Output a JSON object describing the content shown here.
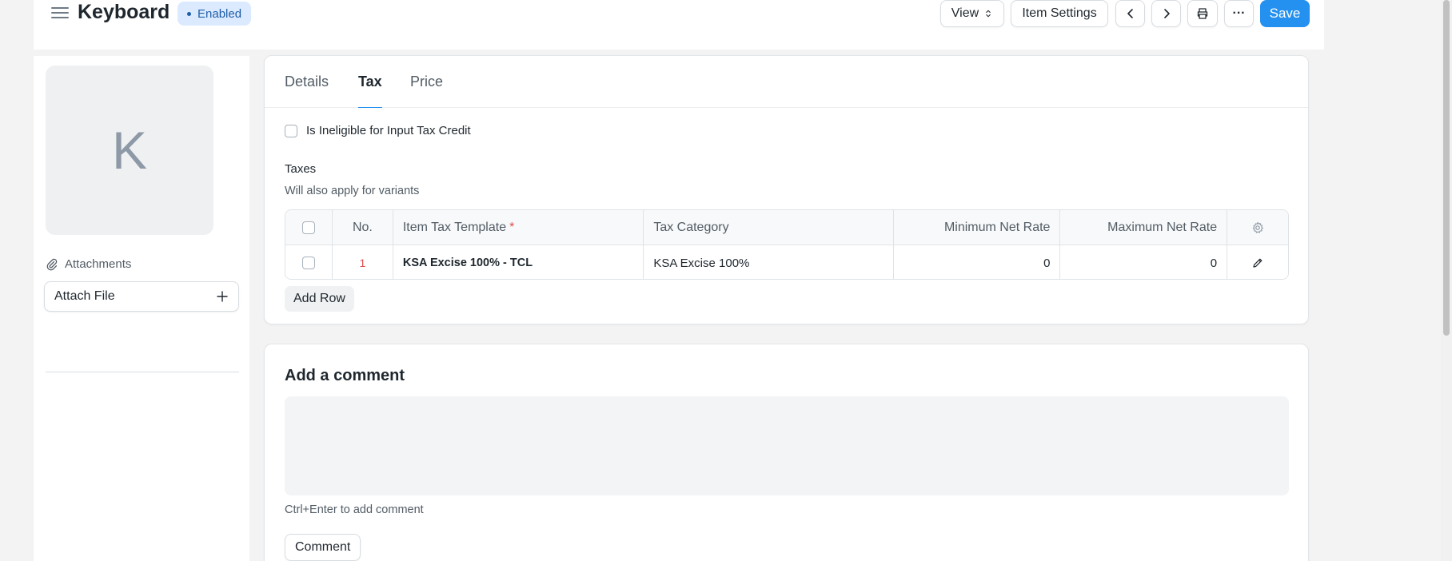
{
  "header": {
    "title": "Keyboard",
    "status_badge": "Enabled",
    "view_label": "View",
    "item_settings_label": "Item Settings",
    "more_label": "···",
    "save_label": "Save"
  },
  "sidebar": {
    "avatar_letter": "K",
    "attachments_label": "Attachments",
    "attach_file_label": "Attach File"
  },
  "tabs": [
    {
      "label": "Details",
      "active": false
    },
    {
      "label": "Tax",
      "active": true
    },
    {
      "label": "Price",
      "active": false
    }
  ],
  "tax_section": {
    "itc_label": "Is Ineligible for Input Tax Credit",
    "taxes_label": "Taxes",
    "taxes_description": "Will also apply for variants",
    "columns": {
      "no": "No.",
      "item_tax_template": "Item Tax Template",
      "required_mark": "*",
      "tax_category": "Tax Category",
      "minimum_net_rate": "Minimum Net Rate",
      "maximum_net_rate": "Maximum Net Rate"
    },
    "rows": [
      {
        "no": "1",
        "item_tax_template": "KSA Excise 100% - TCL",
        "tax_category": "KSA Excise 100%",
        "minimum_net_rate": "0",
        "maximum_net_rate": "0"
      }
    ],
    "add_row_label": "Add Row"
  },
  "comment_section": {
    "title": "Add a comment",
    "hint": "Ctrl+Enter to add comment",
    "button_label": "Comment"
  },
  "colors": {
    "primary": "#2490ef",
    "badge_bg": "#dbeafe",
    "badge_text": "#1f5ea8",
    "required": "#e24c4c"
  },
  "icons": [
    "hamburger-icon",
    "sort-icon",
    "chevron-left-icon",
    "chevron-right-icon",
    "printer-icon",
    "paperclip-icon",
    "plus-icon",
    "gear-icon",
    "pencil-icon"
  ]
}
